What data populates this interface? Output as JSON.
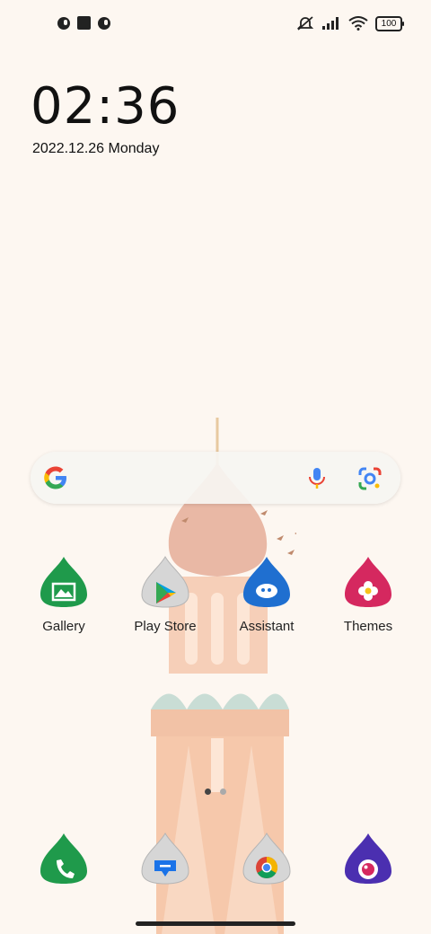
{
  "status_bar": {
    "battery": "100",
    "icons": [
      "notification-icon-1",
      "stop-icon",
      "notification-icon-2",
      "mute-icon",
      "signal-icon",
      "wifi-icon",
      "battery-icon"
    ]
  },
  "lockclock": {
    "time": "02:36",
    "date": "2022.12.26 Monday"
  },
  "search": {
    "icons": [
      "google-logo-icon",
      "mic-icon",
      "lens-icon"
    ]
  },
  "apps_row": [
    {
      "label": "Gallery",
      "color": "#1f9a4b",
      "icon": "gallery-icon"
    },
    {
      "label": "Play Store",
      "color": "#cfcfcf",
      "icon": "play-store-icon"
    },
    {
      "label": "Assistant",
      "color": "#1f6fd0",
      "icon": "assistant-icon"
    },
    {
      "label": "Themes",
      "color": "#d5285f",
      "icon": "themes-icon"
    }
  ],
  "dock": [
    {
      "color": "#1f9a4b",
      "icon": "phone-icon"
    },
    {
      "color": "#cfcfcf",
      "icon": "messages-icon"
    },
    {
      "color": "#cfcfcf",
      "icon": "chrome-icon"
    },
    {
      "color": "#4b2fb0",
      "icon": "camera-icon"
    }
  ]
}
